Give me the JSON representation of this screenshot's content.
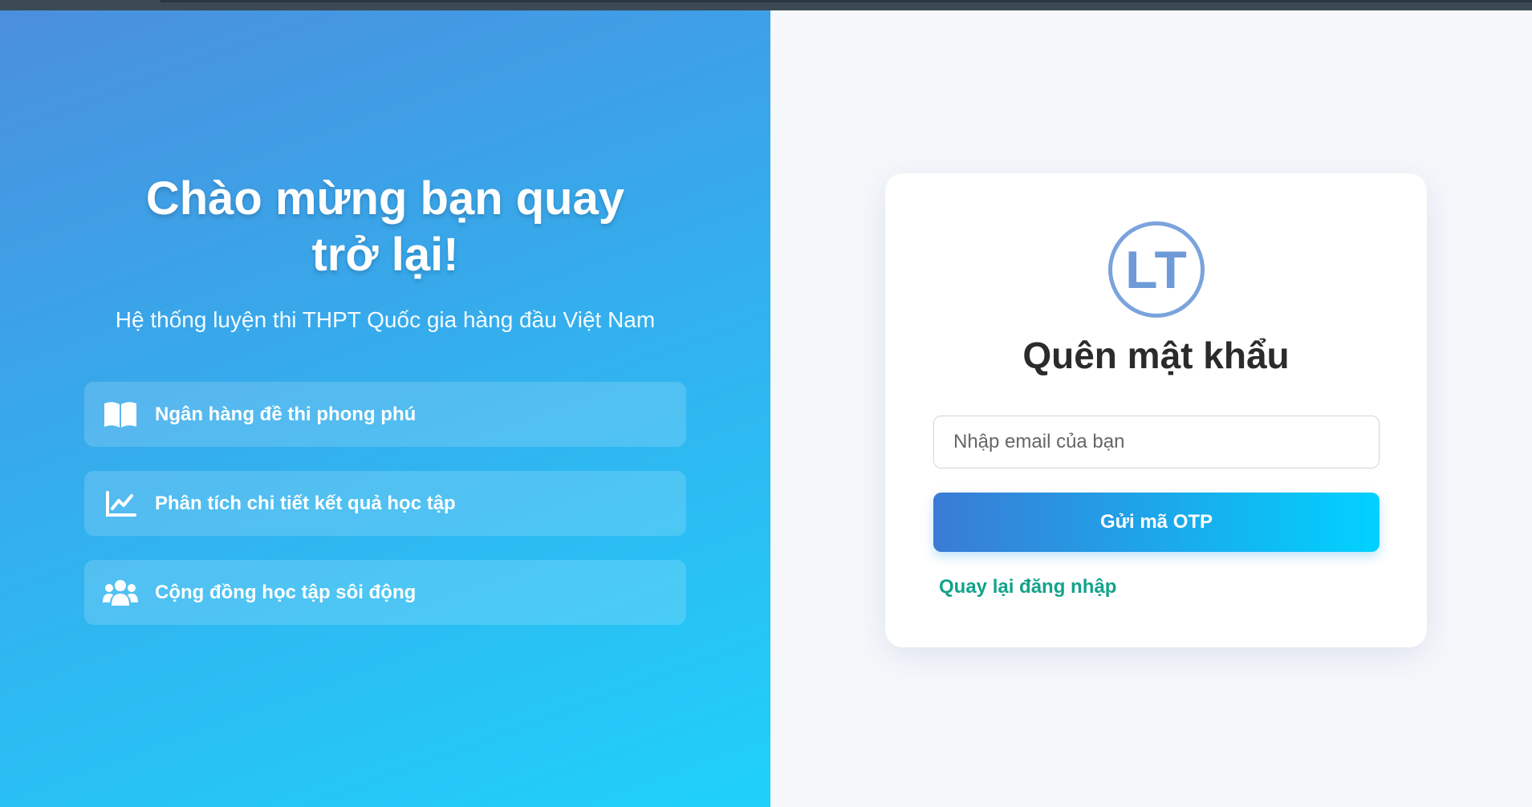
{
  "welcome": {
    "title": "Chào mừng bạn quay trở lại!",
    "subtitle": "Hệ thống luyện thi THPT Quốc gia hàng đầu Việt Nam"
  },
  "features": [
    {
      "icon": "book-open-icon",
      "label": "Ngân hàng đề thi phong phú"
    },
    {
      "icon": "line-chart-icon",
      "label": "Phân tích chi tiết kết quả học tập"
    },
    {
      "icon": "users-icon",
      "label": "Cộng đồng học tập sôi động"
    }
  ],
  "form": {
    "logo_text": "LT",
    "title": "Quên mật khẩu",
    "email_placeholder": "Nhập email của bạn",
    "email_value": "",
    "submit_label": "Gửi mã OTP",
    "back_link": "Quay lại đăng nhập"
  },
  "colors": {
    "gradient_start": "#4b8fde",
    "gradient_end": "#1fd1fb",
    "button_start": "#3a7bd5",
    "button_end": "#00d2ff",
    "link": "#12a38a",
    "logo": "#6f9ad8"
  }
}
